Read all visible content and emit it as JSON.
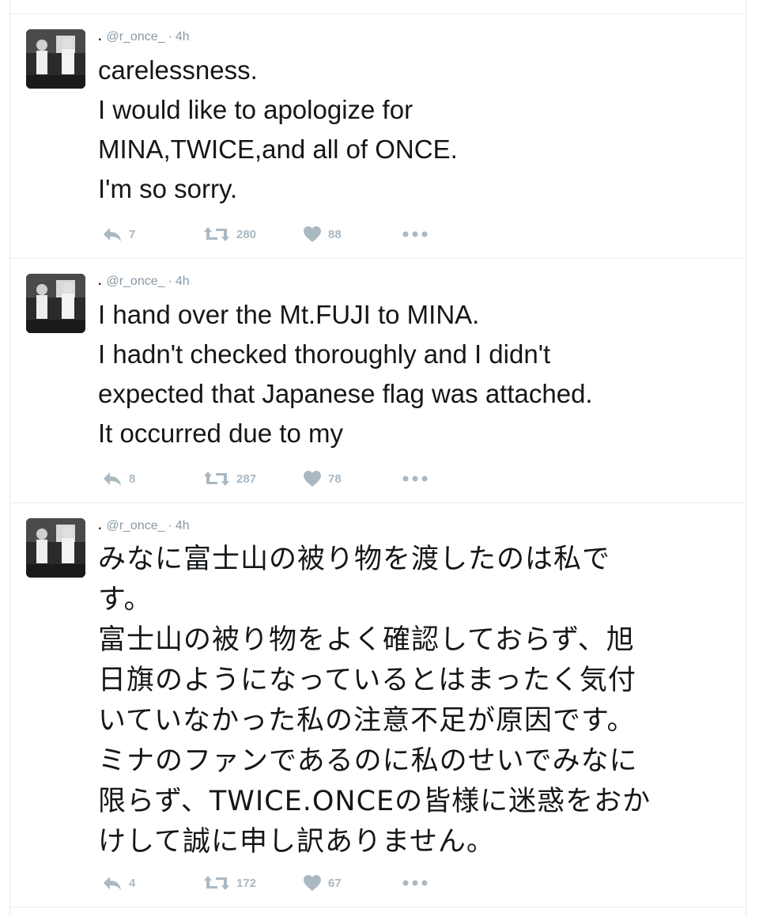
{
  "colors": {
    "text": "#14171a",
    "muted": "#8899a6",
    "action": "#aab8c2",
    "divider": "#e6ecf0"
  },
  "tweets": [
    {
      "name": ".",
      "handle": "@r_once_",
      "separator": "·",
      "time": "4h",
      "text": "carelessness.\nI would like to apologize for\nMINA,TWICE,and all of ONCE.\nI'm so sorry.",
      "replies": "7",
      "retweets": "280",
      "likes": "88",
      "icons": [
        "reply-icon",
        "retweet-icon",
        "heart-icon",
        "more-icon"
      ]
    },
    {
      "name": ".",
      "handle": "@r_once_",
      "separator": "·",
      "time": "4h",
      "text": "I hand over the Mt.FUJI to MINA.\nI hadn't checked thoroughly and I didn't\nexpected that Japanese flag was attached.\nIt occurred due to my",
      "replies": "8",
      "retweets": "287",
      "likes": "78",
      "icons": [
        "reply-icon",
        "retweet-icon",
        "heart-icon",
        "more-icon"
      ]
    },
    {
      "name": ".",
      "handle": "@r_once_",
      "separator": "·",
      "time": "4h",
      "text": "みなに富士山の被り物を渡したのは私で\nす。\n富士山の被り物をよく確認しておらず、旭\n日旗のようになっているとはまったく気付\nいていなかった私の注意不足が原因です。\nミナのファンであるのに私のせいでみなに\n限らず、TWICE.ONCEの皆様に迷惑をおか\nけして誠に申し訳ありません。",
      "replies": "4",
      "retweets": "172",
      "likes": "67",
      "icons": [
        "reply-icon",
        "retweet-icon",
        "heart-icon",
        "more-icon"
      ]
    }
  ]
}
